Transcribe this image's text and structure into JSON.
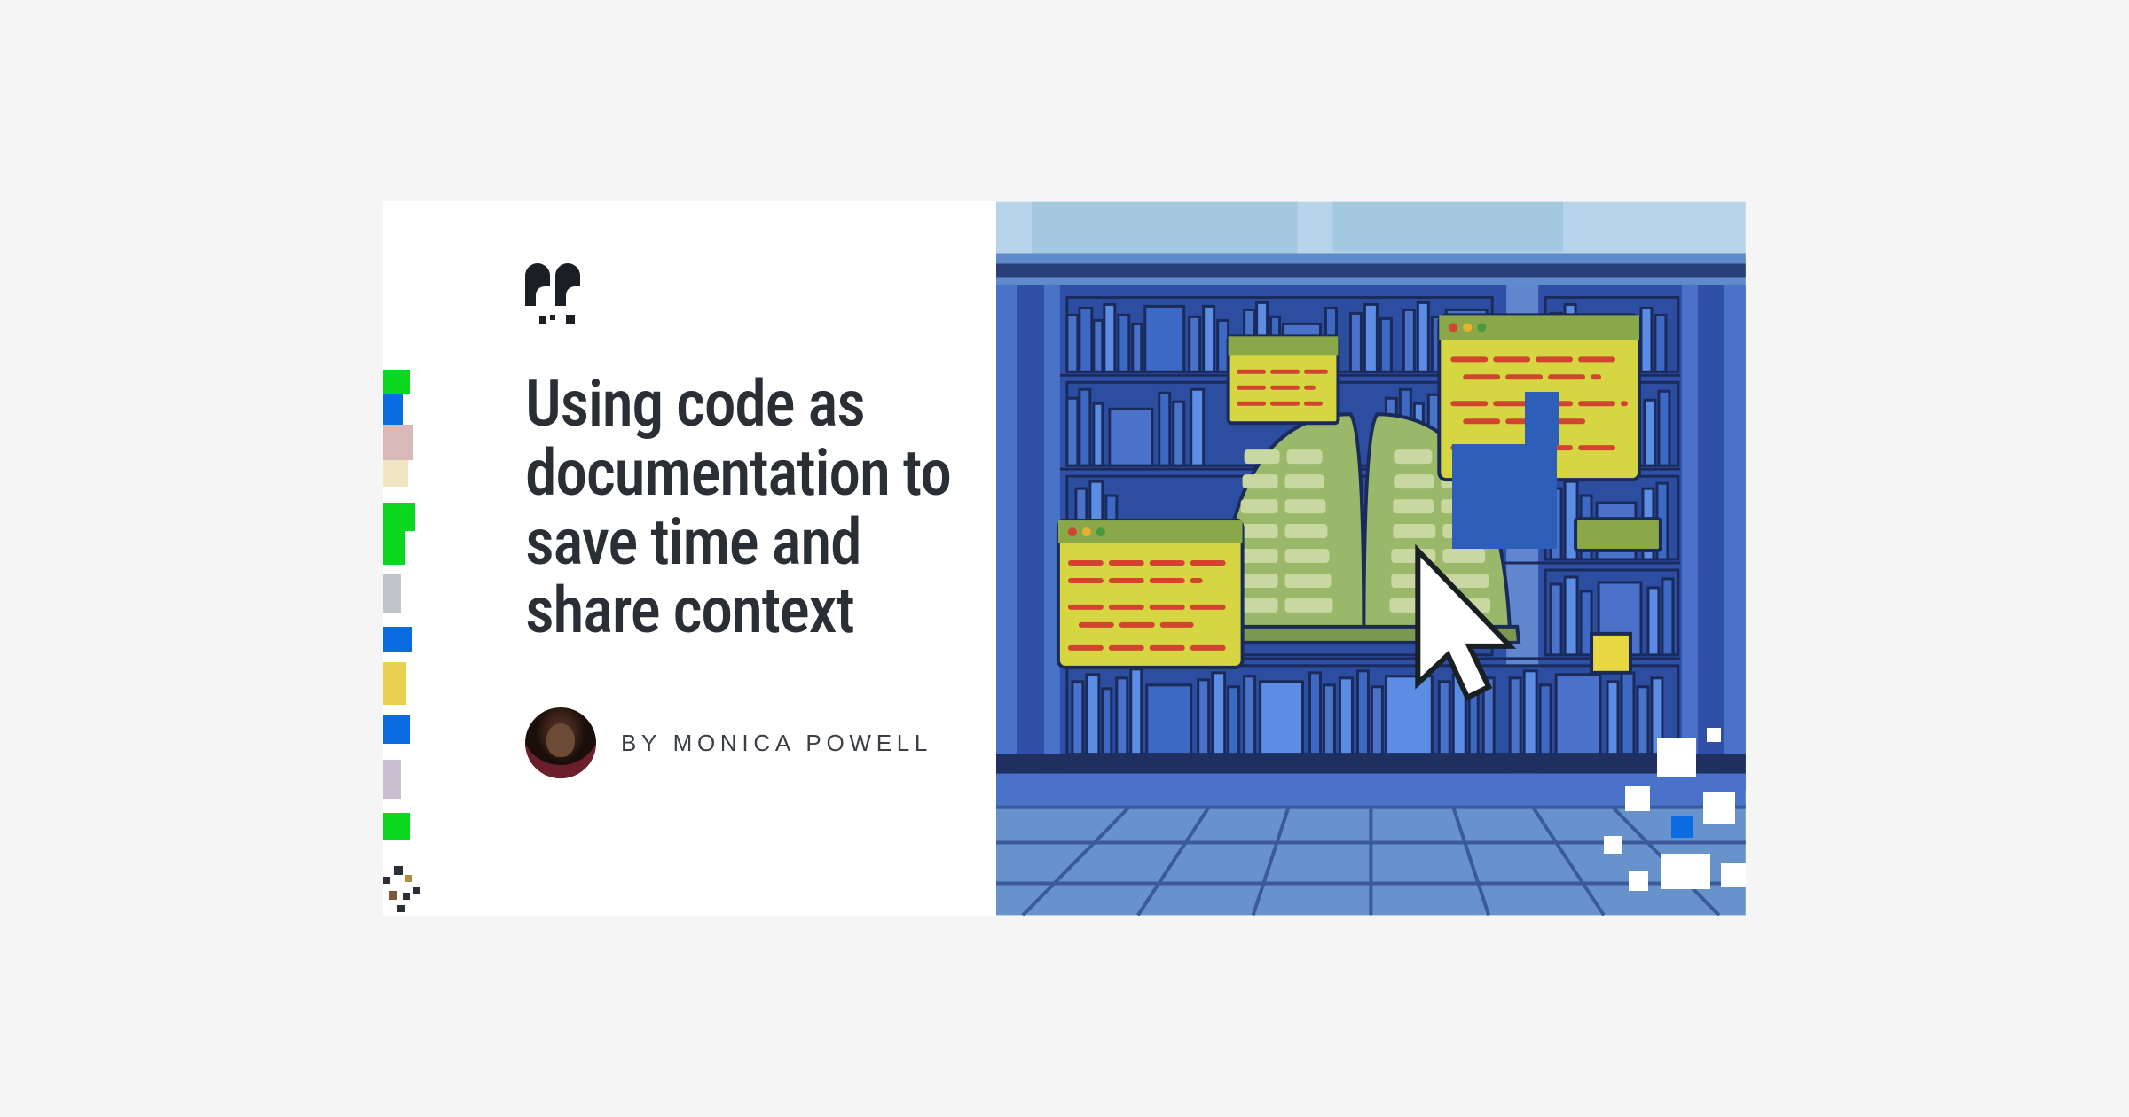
{
  "quote_icon": "double-quote-icon",
  "title": "Using code as documentation to save time and share context",
  "byline_prefix": "BY",
  "author_name": "MONICA POWELL",
  "byline_full": "BY MONICA POWELL",
  "colors": {
    "text_dark": "#2a2f35",
    "library_blue_dark": "#2d4ea0",
    "library_blue_mid": "#3d68c4",
    "library_blue_light": "#5a8de3",
    "window_yellow": "#d6d642",
    "window_green": "#8aa84a",
    "code_red": "#d14530",
    "book_green": "#9ab86a",
    "sky_blue": "#b8d4ea",
    "accent_green": "#0ac818",
    "accent_blue": "#0b6be1"
  }
}
